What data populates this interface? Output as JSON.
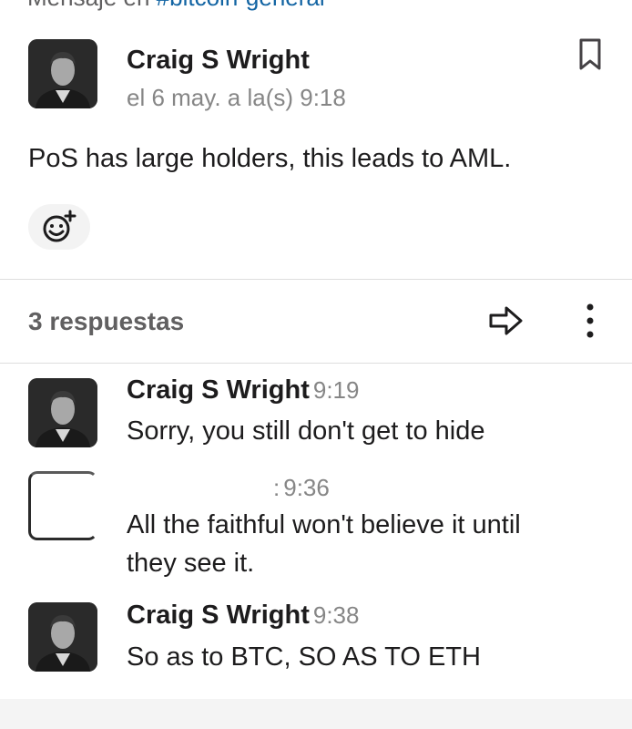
{
  "header": {
    "context_prefix": "Mensaje en",
    "context_channel": "#bitcoin-general"
  },
  "parent_message": {
    "author": "Craig S Wright",
    "date": "el 6 may. a la(s) 9:18",
    "text": "PoS has large holders, this leads to AML."
  },
  "thread_bar": {
    "replies_label": "3 respuestas"
  },
  "replies": [
    {
      "author": "Craig S Wright",
      "time": "9:19",
      "text": "Sorry, you still don't get to hide"
    },
    {
      "author": "",
      "time": "9:36",
      "mark": ":",
      "text_line1": "All the faithful won't believe it until",
      "text_line2": "they see it."
    },
    {
      "author": "Craig S Wright",
      "time": "9:38",
      "text": "So as to BTC, SO AS TO ETH"
    }
  ],
  "icons": {
    "bookmark": "bookmark-icon",
    "reaction": "add-reaction-icon",
    "share": "share-arrow-icon",
    "more": "more-vertical-icon"
  },
  "colors": {
    "link": "#1264a3",
    "muted": "#868686",
    "text": "#1d1c1d"
  }
}
